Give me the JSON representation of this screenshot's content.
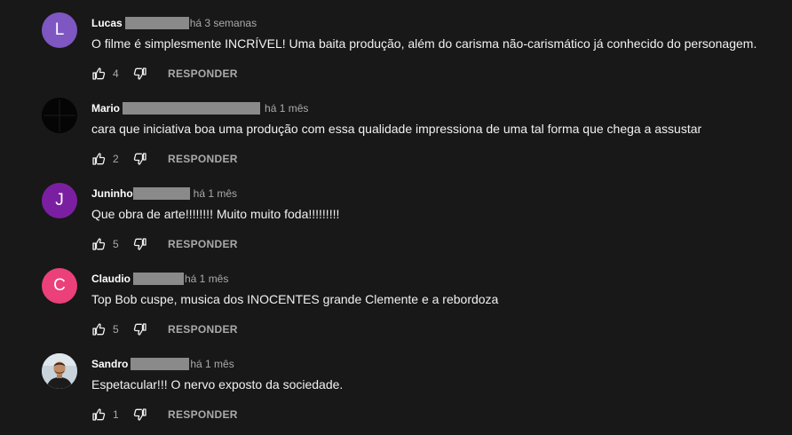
{
  "colors": {
    "background": "#181818",
    "text": "#f1f1f1",
    "secondary": "#aaaaaa",
    "redaction": "#8a8a8a"
  },
  "comments": [
    {
      "author": "Lucas",
      "time": "há 3 semanas",
      "text": "O filme é simplesmente INCRÍVEL! Uma baita produção, além do carisma não-carismático já conhecido do personagem.",
      "likes": "4",
      "reply_label": "RESPONDER",
      "avatar_letter": "L",
      "avatar_color": "#7e57c2"
    },
    {
      "author": "Mario",
      "time": "há 1 mês",
      "text": "cara que iniciativa boa uma produção com essa qualidade impressiona de uma tal forma que chega a assustar",
      "likes": "2",
      "reply_label": "RESPONDER",
      "avatar_letter": "",
      "avatar_color": "#050505"
    },
    {
      "author": "Juninho",
      "time": "há 1 mês",
      "text": "Que obra de arte!!!!!!!! Muito muito foda!!!!!!!!!",
      "likes": "5",
      "reply_label": "RESPONDER",
      "avatar_letter": "J",
      "avatar_color": "#7b1fa2"
    },
    {
      "author": "Claudio",
      "time": "há 1 mês",
      "text": "Top Bob cuspe,  musica dos INOCENTES grande Clemente e a rebordoza",
      "likes": "5",
      "reply_label": "RESPONDER",
      "avatar_letter": "C",
      "avatar_color": "#ec407a"
    },
    {
      "author": "Sandro",
      "time": "há 1 mês",
      "text": "Espetacular!!! O nervo exposto da sociedade.",
      "likes": "1",
      "reply_label": "RESPONDER",
      "avatar_letter": "",
      "avatar_color": "#c9d3dc"
    }
  ]
}
